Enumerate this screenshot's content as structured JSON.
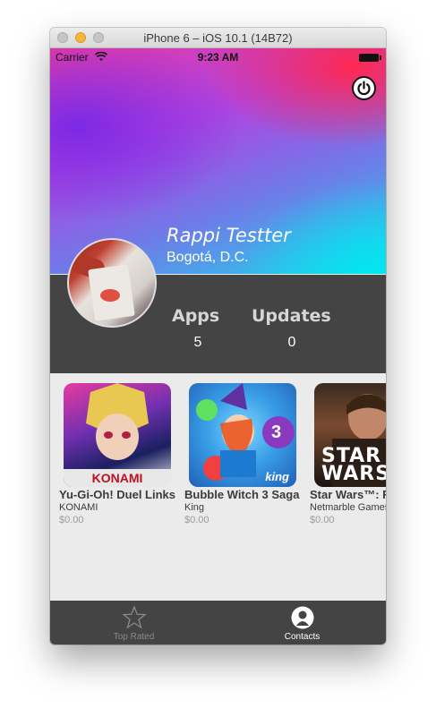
{
  "window": {
    "title": "iPhone 6 – iOS 10.1 (14B72)"
  },
  "status_bar": {
    "carrier": "Carrier",
    "time": "9:23 AM"
  },
  "profile": {
    "name": "Rappi Testter",
    "location": "Bogotá, D.C.",
    "stats": [
      {
        "label": "Apps",
        "value": "5"
      },
      {
        "label": "Updates",
        "value": "0"
      }
    ]
  },
  "apps": [
    {
      "name": "Yu-Gi-Oh! Duel Links",
      "developer": "KONAMI",
      "price": "$0.00",
      "icon_text": "KONAMI"
    },
    {
      "name": "Bubble Witch 3 Saga",
      "developer": "King",
      "price": "$0.00",
      "icon_text": "king"
    },
    {
      "name": "Star Wars™: Force Arena",
      "developer": "Netmarble Games",
      "price": "$0.00",
      "icon_text": "STAR WARS"
    }
  ],
  "tabbar": {
    "items": [
      {
        "label": "Top Rated",
        "icon": "star-icon",
        "active": false
      },
      {
        "label": "Contacts",
        "icon": "contact-icon",
        "active": true
      }
    ]
  },
  "colors": {
    "accent_active": "#ffffff",
    "inactive": "#8a8a8a",
    "dark_panel": "#444444"
  }
}
